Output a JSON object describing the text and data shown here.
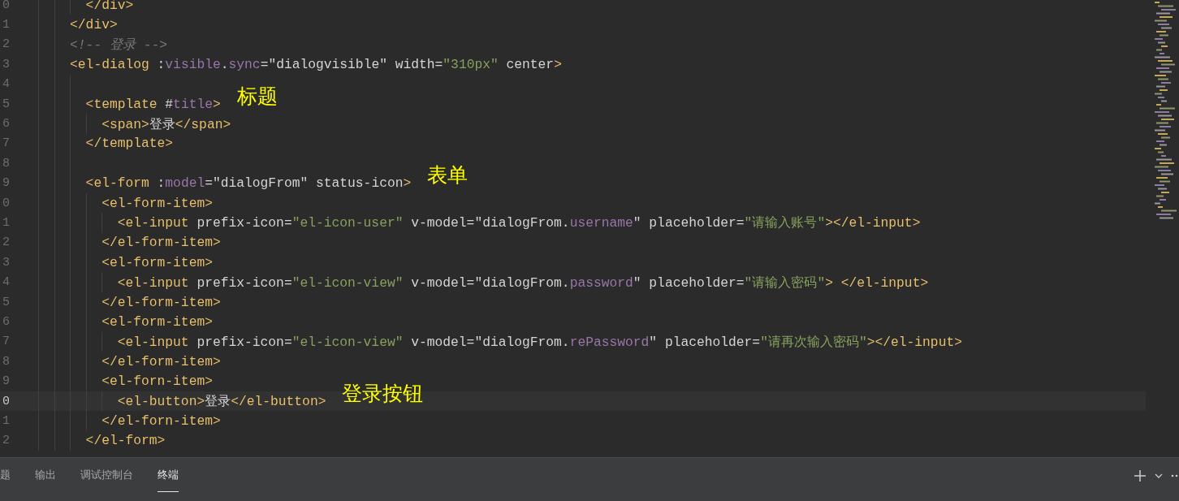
{
  "editor": {
    "lines": [
      {
        "number": "0",
        "active": false,
        "tokens": [
          {
            "kind": "tag",
            "t": "      </div>"
          }
        ]
      },
      {
        "number": "1",
        "active": false,
        "tokens": [
          {
            "kind": "tag",
            "t": "    </div>"
          }
        ]
      },
      {
        "number": "2",
        "active": false,
        "tokens": [
          {
            "kind": "comment",
            "t": "    <!-- 登录 -->"
          }
        ]
      },
      {
        "number": "3",
        "active": false,
        "tokens": [
          {
            "kind": "tag",
            "t": "    <el-dialog"
          },
          {
            "kind": "text",
            "t": " :"
          },
          {
            "kind": "attribute",
            "t": "visible"
          },
          {
            "kind": "text",
            "t": "."
          },
          {
            "kind": "attribute",
            "t": "sync"
          },
          {
            "kind": "text",
            "t": "=\"dialogvisible\" width="
          },
          {
            "kind": "string",
            "t": "\"310px\""
          },
          {
            "kind": "text",
            "t": " center"
          },
          {
            "kind": "tag",
            "t": ">"
          }
        ]
      },
      {
        "number": "4",
        "active": false
      },
      {
        "number": "5",
        "active": false,
        "tokens": [
          {
            "kind": "tag",
            "t": "      <template"
          },
          {
            "kind": "text",
            "t": " #"
          },
          {
            "kind": "attribute",
            "t": "title"
          },
          {
            "kind": "tag",
            "t": ">"
          }
        ],
        "note": "标题"
      },
      {
        "number": "6",
        "active": false,
        "tokens": [
          {
            "kind": "tag",
            "t": "        <span>"
          },
          {
            "kind": "text",
            "t": "登录"
          },
          {
            "kind": "tag",
            "t": "</span>"
          }
        ]
      },
      {
        "number": "7",
        "active": false,
        "tokens": [
          {
            "kind": "tag",
            "t": "      </template>"
          }
        ]
      },
      {
        "number": "8",
        "active": false
      },
      {
        "number": "9",
        "active": false,
        "tokens": [
          {
            "kind": "tag",
            "t": "      <el-form"
          },
          {
            "kind": "text",
            "t": " :"
          },
          {
            "kind": "attribute",
            "t": "model"
          },
          {
            "kind": "text",
            "t": "=\"dialogFrom\" status-icon"
          },
          {
            "kind": "tag",
            "t": ">"
          }
        ],
        "note": "表单"
      },
      {
        "number": "0",
        "active": false,
        "tokens": [
          {
            "kind": "tag",
            "t": "        <el-form-item>"
          }
        ]
      },
      {
        "number": "1",
        "active": false,
        "tokens": [
          {
            "kind": "tag",
            "t": "          <el-input"
          },
          {
            "kind": "text",
            "t": " prefix-icon="
          },
          {
            "kind": "string",
            "t": "\"el-icon-user\""
          },
          {
            "kind": "text",
            "t": " v-model=\"dialogFrom."
          },
          {
            "kind": "attribute",
            "t": "username"
          },
          {
            "kind": "text",
            "t": "\" placeholder="
          },
          {
            "kind": "string",
            "t": "\"请输入账号\""
          },
          {
            "kind": "tag",
            "t": "></el-input>"
          }
        ]
      },
      {
        "number": "2",
        "active": false,
        "tokens": [
          {
            "kind": "tag",
            "t": "        </el-form-item>"
          }
        ]
      },
      {
        "number": "3",
        "active": false,
        "tokens": [
          {
            "kind": "tag",
            "t": "        <el-form-item>"
          }
        ]
      },
      {
        "number": "4",
        "active": false,
        "tokens": [
          {
            "kind": "tag",
            "t": "          <el-input"
          },
          {
            "kind": "text",
            "t": " prefix-icon="
          },
          {
            "kind": "string",
            "t": "\"el-icon-view\""
          },
          {
            "kind": "text",
            "t": " v-model=\"dialogFrom."
          },
          {
            "kind": "attribute",
            "t": "password"
          },
          {
            "kind": "text",
            "t": "\" placeholder="
          },
          {
            "kind": "string",
            "t": "\"请输入密码\""
          },
          {
            "kind": "tag",
            "t": "> </el-input>"
          }
        ]
      },
      {
        "number": "5",
        "active": false,
        "tokens": [
          {
            "kind": "tag",
            "t": "        </el-form-item>"
          }
        ]
      },
      {
        "number": "6",
        "active": false,
        "tokens": [
          {
            "kind": "tag",
            "t": "        <el-form-item>"
          }
        ]
      },
      {
        "number": "7",
        "active": false,
        "tokens": [
          {
            "kind": "tag",
            "t": "          <el-input"
          },
          {
            "kind": "text",
            "t": " prefix-icon="
          },
          {
            "kind": "string",
            "t": "\"el-icon-view\""
          },
          {
            "kind": "text",
            "t": " v-model=\"dialogFrom."
          },
          {
            "kind": "attribute",
            "t": "rePassword"
          },
          {
            "kind": "text",
            "t": "\" placeholder="
          },
          {
            "kind": "string",
            "t": "\"请再次输入密码\""
          },
          {
            "kind": "tag",
            "t": "></el-input>"
          }
        ]
      },
      {
        "number": "8",
        "active": false,
        "tokens": [
          {
            "kind": "tag",
            "t": "        </el-form-item>"
          }
        ]
      },
      {
        "number": "9",
        "active": false,
        "tokens": [
          {
            "kind": "tag",
            "t": "        <el-forn-item>"
          }
        ]
      },
      {
        "number": "0",
        "active": true,
        "tokens": [
          {
            "kind": "tag",
            "t": "          <el-button>"
          },
          {
            "kind": "text",
            "t": "登录"
          },
          {
            "kind": "tag",
            "t": "</el-button>"
          }
        ],
        "note": "登录按钮"
      },
      {
        "number": "1",
        "active": false,
        "tokens": [
          {
            "kind": "tag",
            "t": "        </el-forn-item>"
          }
        ]
      },
      {
        "number": "2",
        "active": false,
        "tokens": [
          {
            "kind": "tag",
            "t": "      </el-form>"
          }
        ]
      }
    ]
  },
  "panel": {
    "tabs": [
      {
        "label": "题",
        "selected": false
      },
      {
        "label": "输出",
        "selected": false
      },
      {
        "label": "调试控制台",
        "selected": false
      },
      {
        "label": "终端",
        "selected": true
      }
    ]
  }
}
